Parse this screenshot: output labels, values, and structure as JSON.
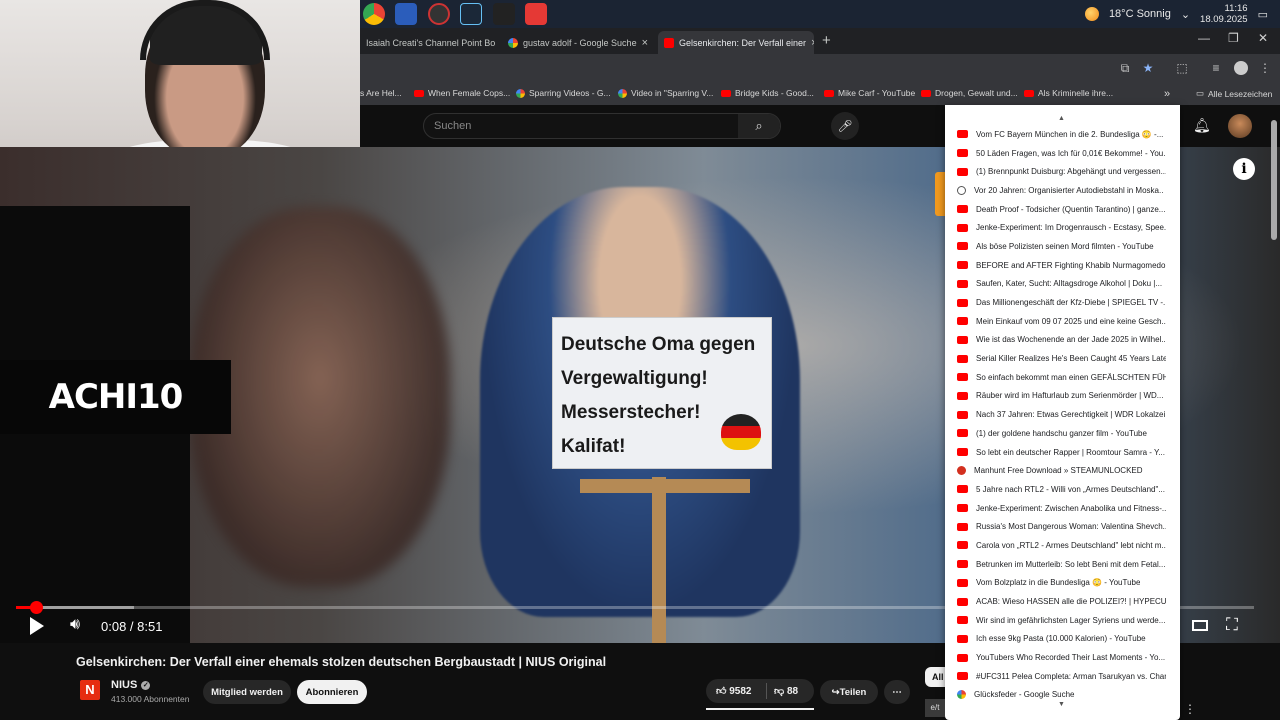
{
  "tray": {
    "weather": "18°C Sonnig",
    "time": "11:16",
    "date": "18.09.2025"
  },
  "tabs": [
    {
      "label": "Isaiah Creati's Channel Point Bo",
      "active": false
    },
    {
      "label": "gustav adolf - Google Suche",
      "active": false
    },
    {
      "label": "Gelsenkirchen: Der Verfall einer",
      "active": true
    }
  ],
  "bookmarks": {
    "items": [
      "s Are Hel...",
      "When Female Cops...",
      "Sparring Videos - G...",
      "Video in \"Sparring V...",
      "Bridge Kids - Good...",
      "Mike Carf - YouTube",
      "Drogen, Gewalt und...",
      "Als Kriminelle ihre..."
    ],
    "all_label": "Alle Lesezeichen"
  },
  "masthead": {
    "search_placeholder": "Suchen"
  },
  "overlay": {
    "logo": "ACHI10"
  },
  "sign": {
    "lines": [
      "Deutsche Oma gegen",
      "Vergewaltigung!",
      "Messerstecher!",
      "Kalifat!"
    ]
  },
  "player": {
    "time": "0:08 / 8:51",
    "progress": 0.016,
    "buffered": 0.095
  },
  "video": {
    "title": "Gelsenkirchen: Der Verfall einer ehemals stolzen deutschen Bergbaustadt | NIUS Original",
    "channel": "NIUS",
    "subscribers": "413.000 Abonnenten",
    "member_label": "Mitglied werden",
    "subscribe_label": "Abonnieren",
    "likes": "9582",
    "dislikes": "88",
    "share_label": "Teilen",
    "right_chip": "All"
  },
  "dropdown": {
    "items": [
      {
        "icon": "yt",
        "label": "Vom FC Bayern München in die 2. Bundesliga 😳 -..."
      },
      {
        "icon": "yt",
        "label": "50 Läden Fragen, was Ich für 0,01€ Bekomme! - You..."
      },
      {
        "icon": "yt",
        "label": "(1) Brennpunkt Duisburg: Abgehängt und vergessen..."
      },
      {
        "icon": "globe",
        "label": "Vor 20 Jahren: Organisierter Autodiebstahl in Moska..."
      },
      {
        "icon": "yt",
        "label": "Death Proof - Todsicher (Quentin Tarantino) | ganze..."
      },
      {
        "icon": "yt",
        "label": "Jenke-Experiment: Im Drogenrausch - Ecstasy, Spee..."
      },
      {
        "icon": "yt",
        "label": "Als böse Polizisten seinen Mord filmten - YouTube"
      },
      {
        "icon": "yt",
        "label": "BEFORE and AFTER Fighting Khabib Nurmagomedo..."
      },
      {
        "icon": "yt",
        "label": "Saufen, Kater, Sucht: Alltagsdroge Alkohol | Doku |..."
      },
      {
        "icon": "yt",
        "label": "Das Millionengeschäft der Kfz-Diebe | SPIEGEL TV -..."
      },
      {
        "icon": "yt",
        "label": "Mein Einkauf vom 09 07 2025 und eine keine Gesch..."
      },
      {
        "icon": "yt",
        "label": "Wie ist das Wochenende an der Jade 2025 in Wilhel..."
      },
      {
        "icon": "yt",
        "label": "Serial Killer Realizes He's Been Caught 45 Years Late..."
      },
      {
        "icon": "yt",
        "label": "So einfach bekommt man einen GEFÄLSCHTEN FÜH..."
      },
      {
        "icon": "yt",
        "label": "Räuber wird im Hafturlaub zum Serienmörder | WD..."
      },
      {
        "icon": "yt",
        "label": "Nach 37 Jahren: Etwas Gerechtigkeit | WDR Lokalzei..."
      },
      {
        "icon": "yt",
        "label": "(1) der goldene handschu ganzer film - YouTube"
      },
      {
        "icon": "yt",
        "label": "So lebt ein deutscher Rapper | Roomtour Samra - Y..."
      },
      {
        "icon": "steam",
        "label": "Manhunt Free Download » STEAMUNLOCKED"
      },
      {
        "icon": "yt",
        "label": "5 Jahre nach RTL2 - Willi von „Armes Deutschland\"..."
      },
      {
        "icon": "yt",
        "label": "Jenke-Experiment: Zwischen Anabolika und Fitness-..."
      },
      {
        "icon": "yt",
        "label": "Russia's Most Dangerous Woman: Valentina Shevch..."
      },
      {
        "icon": "yt",
        "label": "Carola von „RTL2 - Armes Deutschland\" lebt nicht m..."
      },
      {
        "icon": "yt",
        "label": "Betrunken im Mutterleib: So lebt Beni mit dem Fetal..."
      },
      {
        "icon": "yt",
        "label": "Vom Bolzplatz in die Bundesliga 😳 - YouTube"
      },
      {
        "icon": "yt",
        "label": "ACAB: Wieso HASSEN alle die POLIZEI?! | HYPECULT..."
      },
      {
        "icon": "yt",
        "label": "Wir sind im gefährlichsten Lager Syriens und werde..."
      },
      {
        "icon": "yt",
        "label": "Ich esse 9kg Pasta (10.000 Kalorien) - YouTube"
      },
      {
        "icon": "yt",
        "label": "YouTubers Who Recorded Their Last Moments - Yo..."
      },
      {
        "icon": "yt",
        "label": "#UFC311 Pelea Completa: Arman Tsarukyan vs. Char..."
      },
      {
        "icon": "google",
        "label": "Glücksfeder - Google Suche"
      }
    ]
  },
  "bottom_chip": "e/t"
}
